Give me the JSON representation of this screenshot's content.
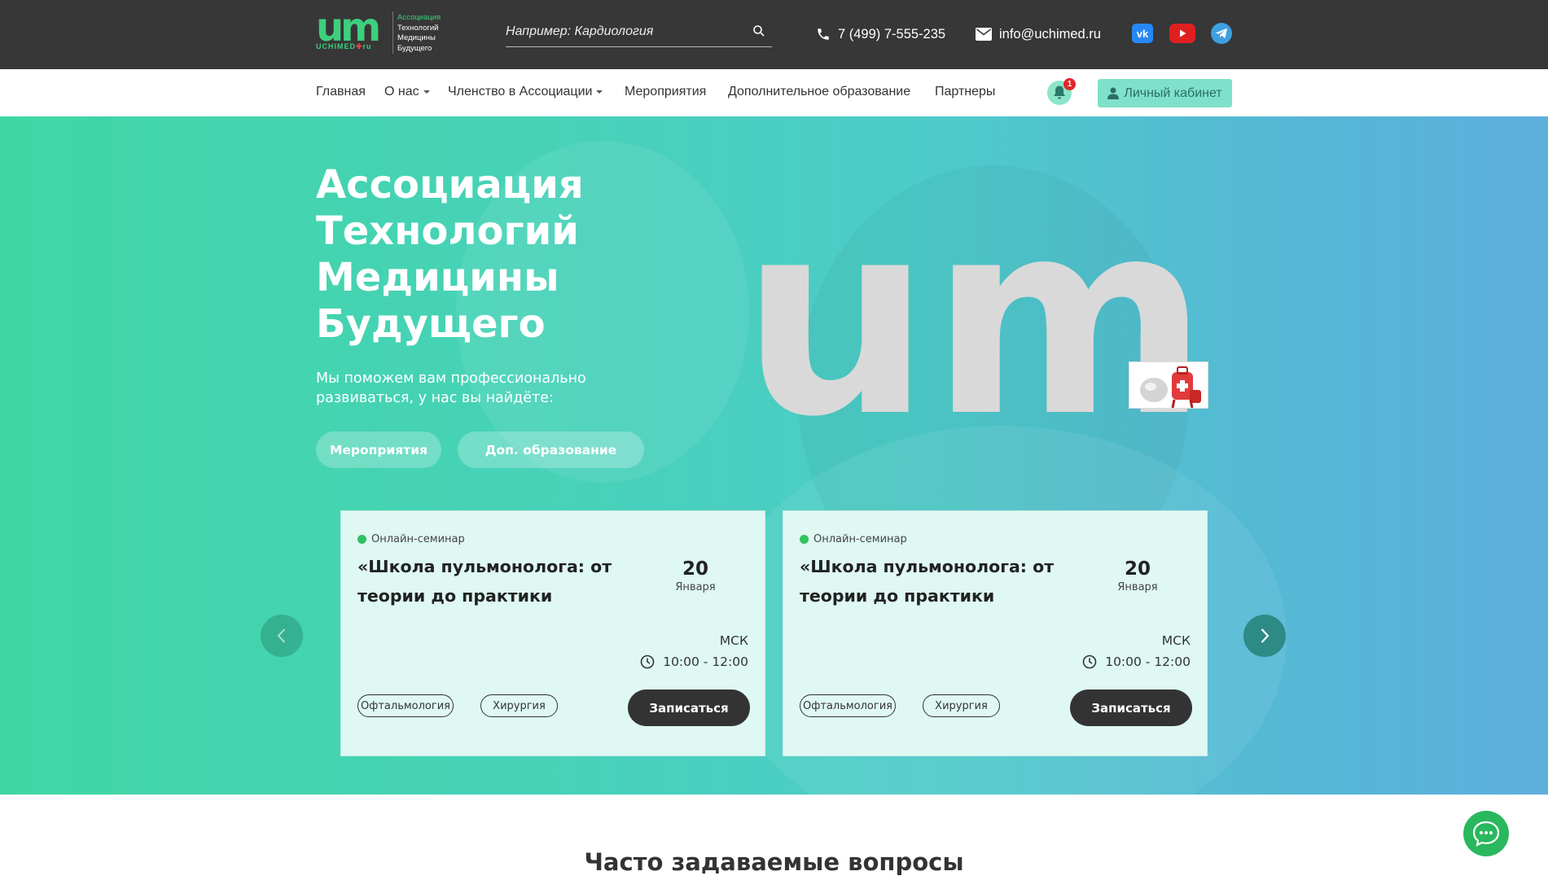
{
  "header": {
    "logo": {
      "mark": "um",
      "sub_prefix": "UCHIMED",
      "sub_suffix": "ru",
      "text_lines": [
        "Ассоциация",
        "Технологий",
        "Медицины",
        "Будущего"
      ]
    },
    "search": {
      "placeholder": "Например: Кардиология",
      "icon": "search-icon"
    },
    "phone": "7 (499) 7-555-235",
    "email": "info@uchimed.ru",
    "social": [
      {
        "name": "vk",
        "label": "vk",
        "color": "#2787f5"
      },
      {
        "name": "youtube",
        "color": "#e02020"
      },
      {
        "name": "telegram",
        "color": "#3da0e0"
      }
    ]
  },
  "nav": {
    "items": [
      {
        "label": "Главная",
        "has_dropdown": false
      },
      {
        "label": "О нас",
        "has_dropdown": true
      },
      {
        "label": "Членство в Ассоциации",
        "has_dropdown": true
      },
      {
        "label": "Мероприятия",
        "has_dropdown": false
      },
      {
        "label": "Дополнительное образование",
        "has_dropdown": false
      },
      {
        "label": "Партнеры",
        "has_dropdown": false
      }
    ],
    "notifications_count": "1",
    "cabinet_label": "Личный кабинет"
  },
  "hero": {
    "title": "Ассоциация Технологий Медицины Будущего",
    "subtitle": "Мы поможем вам профессионально развиваться, у нас вы найдёте:",
    "buttons": [
      "Мероприятия",
      "Доп. образование"
    ],
    "big_logo_text": "um"
  },
  "events": [
    {
      "type": "Онлайн-семинар",
      "title": "«Школа пульмонолога: от теории до практики",
      "day": "20",
      "month": "Января",
      "timezone": "МСК",
      "time": "10:00 - 12:00",
      "tags": [
        "Офтальмология",
        "Хирургия"
      ],
      "cta": "Записаться"
    },
    {
      "type": "Онлайн-семинар",
      "title": "«Школа пульмонолога: от теории до практики",
      "day": "20",
      "month": "Января",
      "timezone": "МСК",
      "time": "10:00 - 12:00",
      "tags": [
        "Офтальмология",
        "Хирургия"
      ],
      "cta": "Записаться"
    }
  ],
  "faq": {
    "title": "Часто задаваемые вопросы"
  },
  "colors": {
    "brand_green": "#3ecf7e",
    "topbar": "#373737",
    "hero_start": "#3fd6a4",
    "hero_end": "#5eafdc",
    "cabinet_button": "#7fe1c9",
    "notification_badge": "#e4262c",
    "chat_button": "#29b85e"
  }
}
